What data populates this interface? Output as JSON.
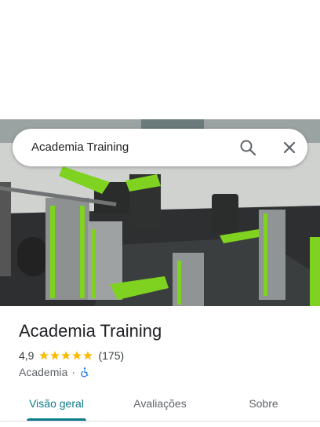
{
  "search": {
    "query": "Academia Training"
  },
  "place": {
    "name": "Academia Training",
    "rating": "4,9",
    "stars": 5,
    "reviews": "(175)",
    "category": "Academia",
    "separator": "·"
  },
  "tabs": [
    {
      "label": "Visão geral",
      "active": true
    },
    {
      "label": "Avaliações",
      "active": false
    },
    {
      "label": "Sobre",
      "active": false
    }
  ],
  "colors": {
    "accent": "#0b7a8b",
    "star": "#fbbc04",
    "machine_green": "#7fd320",
    "accessibility": "#1a73e8"
  }
}
